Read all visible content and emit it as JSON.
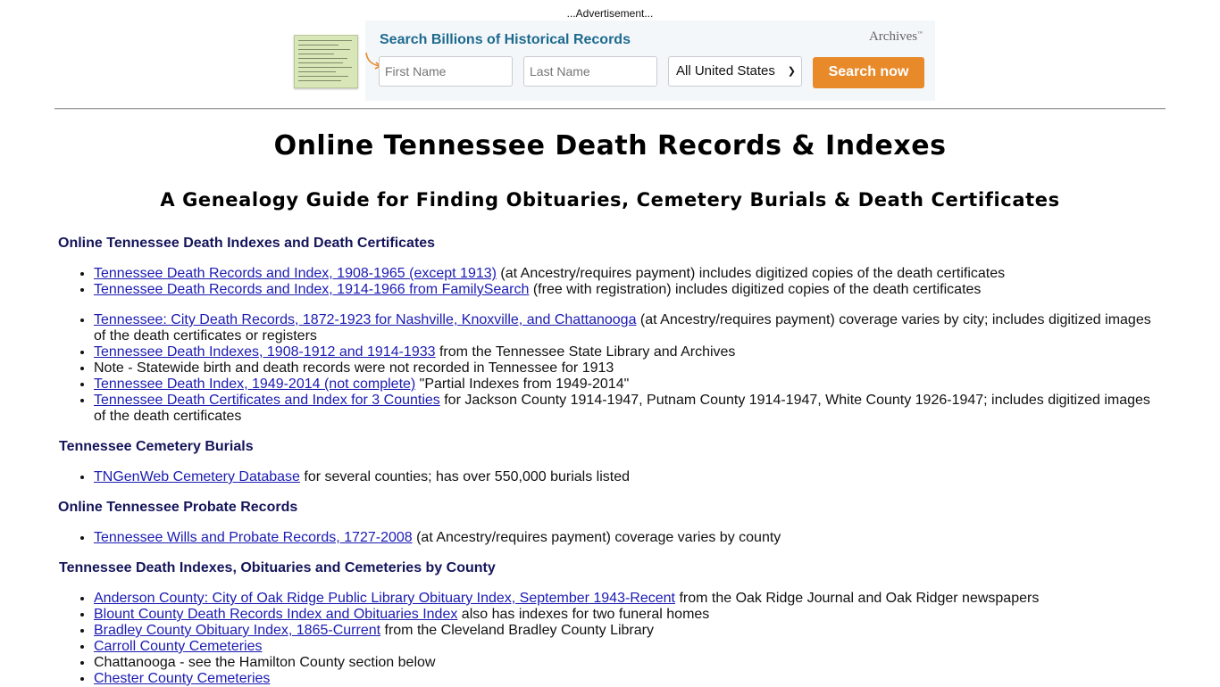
{
  "ad": {
    "label": "...Advertisement...",
    "title": "Search Billions of Historical Records",
    "brand": "Archives",
    "brand_mark": "™",
    "first_name_placeholder": "First Name",
    "last_name_placeholder": "Last Name",
    "location_selected": "All United States",
    "search_button": "Search now",
    "colors": {
      "title": "#1d6a8f",
      "button": "#e88a2a",
      "background": "#f4f7fa"
    }
  },
  "page": {
    "title": "Online Tennessee Death Records & Indexes",
    "subtitle": "A Genealogy Guide for Finding Obituaries, Cemetery Burials & Death Certificates"
  },
  "sections": [
    {
      "heading": "Online Tennessee Death Indexes and Death Certificates",
      "groups": [
        [
          {
            "link": "Tennessee Death Records and Index, 1908-1965 (except 1913)",
            "text": " (at Ancestry/requires payment) includes digitized copies of the death certificates"
          },
          {
            "link": "Tennessee Death Records and Index, 1914-1966 from FamilySearch",
            "text": " (free with registration) includes digitized copies of the death certificates"
          }
        ],
        [
          {
            "link": "Tennessee: City Death Records, 1872-1923 for Nashville, Knoxville, and Chattanooga",
            "text": " (at Ancestry/requires payment) coverage varies by city; includes digitized images of the death certificates or registers"
          },
          {
            "link": "Tennessee Death Indexes, 1908-1912 and 1914-1933",
            "text": " from the Tennessee State Library and Archives"
          },
          {
            "link": "",
            "text": "Note - Statewide birth and death records were not recorded in Tennessee for 1913"
          },
          {
            "link": "Tennessee Death Index, 1949-2014 (not complete)",
            "text": " \"Partial Indexes from 1949-2014\""
          },
          {
            "link": "Tennessee Death Certificates and Index for 3 Counties",
            "text": " for Jackson County 1914-1947, Putnam County 1914-1947, White County 1926-1947; includes digitized images of the death certificates"
          }
        ]
      ]
    },
    {
      "heading": "Tennessee Cemetery Burials",
      "groups": [
        [
          {
            "link": "TNGenWeb Cemetery Database",
            "text": " for several counties; has over 550,000 burials listed"
          }
        ]
      ]
    },
    {
      "heading": "Online Tennessee Probate Records",
      "groups": [
        [
          {
            "link": "Tennessee Wills and Probate Records, 1727-2008",
            "text": " (at Ancestry/requires payment) coverage varies by county"
          }
        ]
      ]
    },
    {
      "heading": "Tennessee Death Indexes, Obituaries and Cemeteries by County",
      "groups": [
        [
          {
            "link": "Anderson County: City of Oak Ridge Public Library Obituary Index, September 1943-Recent",
            "text": " from the Oak Ridge Journal and Oak Ridger newspapers"
          },
          {
            "link": "Blount County Death Records Index and Obituaries Index",
            "text": " also has indexes for two funeral homes"
          },
          {
            "link": "Bradley County Obituary Index, 1865-Current",
            "text": " from the Cleveland Bradley County Library"
          },
          {
            "link": "Carroll County Cemeteries",
            "text": ""
          },
          {
            "link": "",
            "text": "Chattanooga - see the Hamilton County section below"
          },
          {
            "link": "Chester County Cemeteries",
            "text": ""
          }
        ]
      ]
    }
  ]
}
